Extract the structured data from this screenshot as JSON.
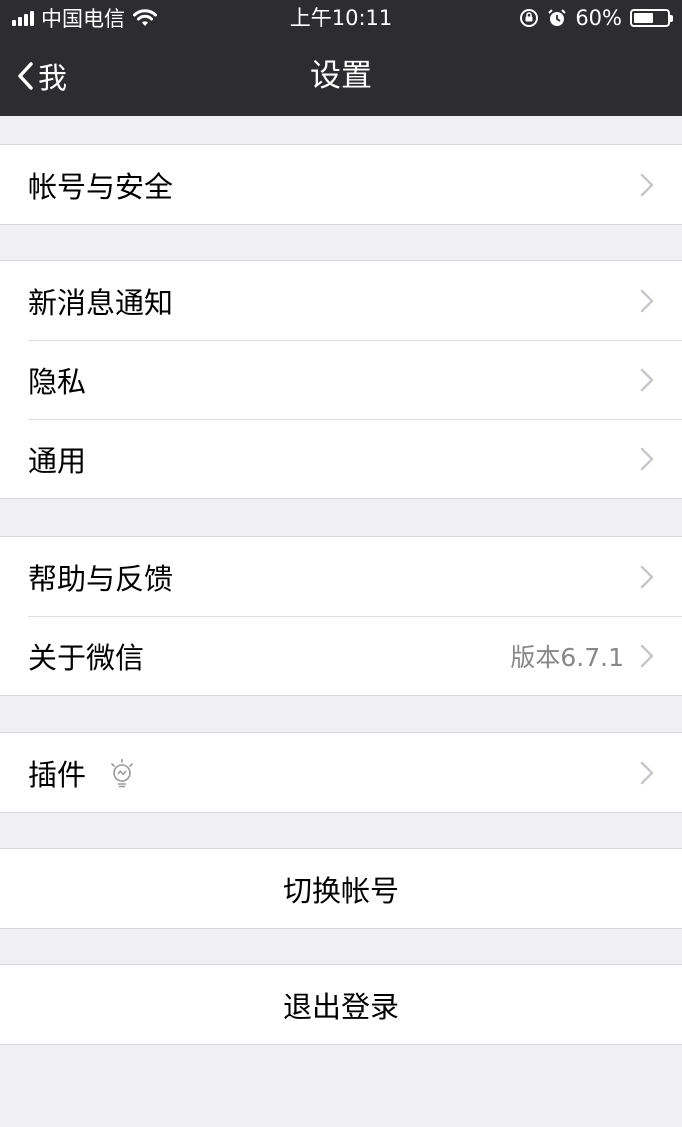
{
  "status_bar": {
    "carrier": "中国电信",
    "time": "上午10:11",
    "battery_percent": "60%",
    "battery_level": 0.6
  },
  "nav": {
    "back_label": "我",
    "title": "设置"
  },
  "groups": [
    {
      "items": [
        {
          "label": "帐号与安全"
        }
      ]
    },
    {
      "items": [
        {
          "label": "新消息通知"
        },
        {
          "label": "隐私"
        },
        {
          "label": "通用"
        }
      ]
    },
    {
      "items": [
        {
          "label": "帮助与反馈"
        },
        {
          "label": "关于微信",
          "detail": "版本6.7.1"
        }
      ]
    },
    {
      "items": [
        {
          "label": "插件"
        }
      ]
    }
  ],
  "actions": {
    "switch_account": "切换帐号",
    "logout": "退出登录"
  },
  "colors": {
    "nav_background": "#2d2d30",
    "page_background": "#efeff4",
    "cell_background": "#ffffff",
    "detail_text": "#888888",
    "chevron": "#c7c7cc"
  }
}
